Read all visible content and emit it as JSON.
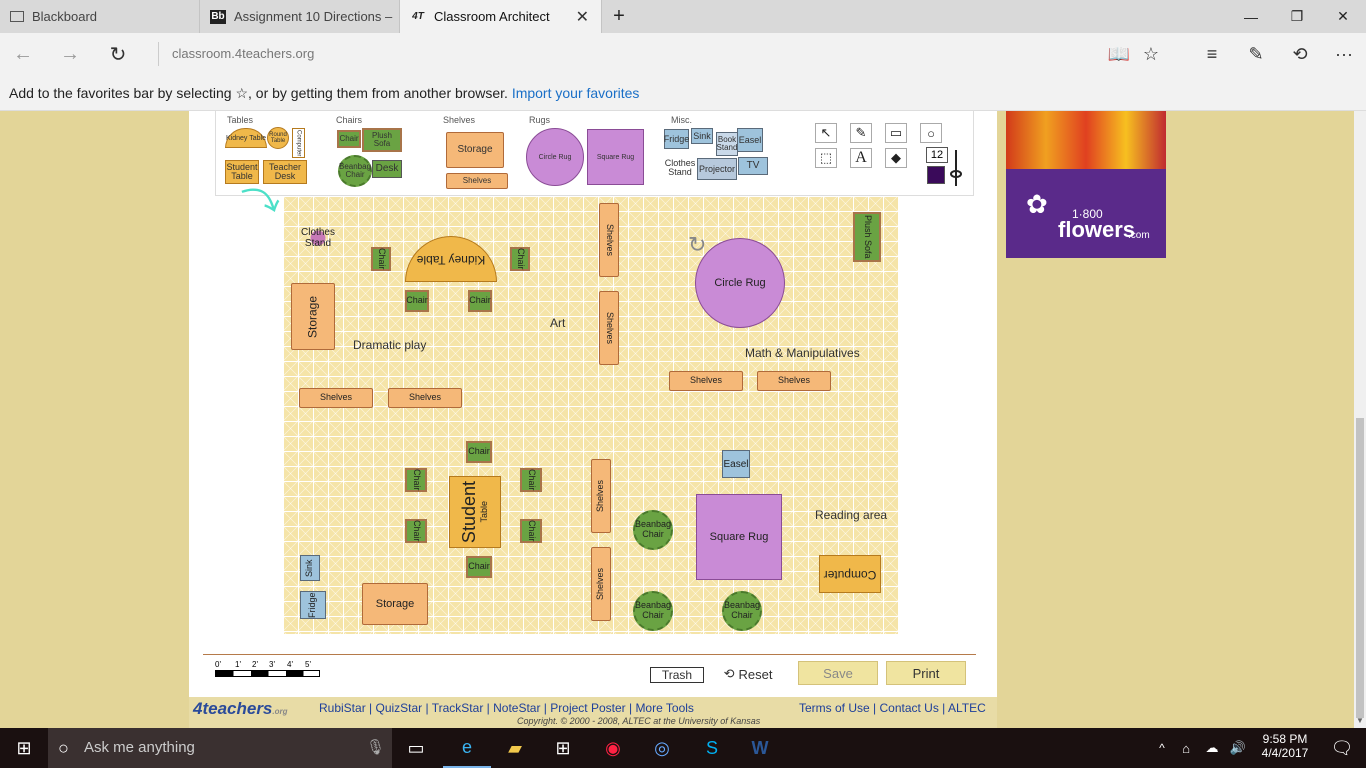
{
  "tabs": [
    {
      "label": "Blackboard",
      "icon": "window-icon"
    },
    {
      "label": "Assignment 10 Directions –",
      "icon": "Bb"
    },
    {
      "label": "Classroom Architect",
      "icon": "4T"
    }
  ],
  "address": {
    "url": "classroom.4teachers.org"
  },
  "favbar": {
    "text": "Add to the favorites bar by selecting ☆, or by getting them from another browser.",
    "link": "Import your favorites"
  },
  "palette": {
    "sections": {
      "tables": "Tables",
      "chairs": "Chairs",
      "shelves": "Shelves",
      "rugs": "Rugs",
      "misc": "Misc."
    },
    "tables": [
      "Kidney Table",
      "Round Table",
      "Computer",
      "Student Table",
      "Teacher Desk"
    ],
    "chairs": [
      "Chair",
      "Plush Sofa",
      "Beanbag Chair",
      "Desk"
    ],
    "shelves": [
      "Storage",
      "Shelves"
    ],
    "rugs": [
      "Circle Rug",
      "Square Rug"
    ],
    "misc": [
      "Fridge",
      "Sink",
      "Book Stand",
      "Easel",
      "Clothes Stand",
      "Projector",
      "TV"
    ],
    "font_size": "12"
  },
  "room": {
    "clothes_stand": "Clothes Stand",
    "kidney": "Kidney Table",
    "chair": "Chair",
    "storage": "Storage",
    "shelves": "Shelves",
    "circle_rug": "Circle Rug",
    "plush_sofa": "Plush Sofa",
    "student": "Student",
    "table": "Table",
    "easel": "Easel",
    "beanbag": "Beanbag Chair",
    "square_rug": "Square Rug",
    "computer": "Computer",
    "sink": "Sink",
    "fridge": "Fridge",
    "labels": {
      "dramatic": "Dramatic play",
      "art": "Art",
      "math": "Math & Manipulatives",
      "reading": "Reading area"
    }
  },
  "scale": {
    "ticks": [
      "0'",
      "1'",
      "2'",
      "3'",
      "4'",
      "5'"
    ]
  },
  "actions": {
    "trash": "Trash",
    "reset": "Reset",
    "save": "Save",
    "print": "Print"
  },
  "footer": {
    "logo": "4teachers",
    "logo_suffix": ".org",
    "links": [
      "RubiStar",
      "QuizStar",
      "TrackStar",
      "NoteStar",
      "Project Poster",
      "More Tools"
    ],
    "right_links": [
      "Terms of Use",
      "Contact Us",
      "ALTEC"
    ],
    "copyright": "Copyright. © 2000 - 2008, ALTEC at the University of Kansas"
  },
  "ad": {
    "brand": "1·800",
    "brand2": "flowers",
    "suffix": ".com"
  },
  "taskbar": {
    "search": "Ask me anything",
    "time": "9:58 PM",
    "date": "4/4/2017"
  },
  "colors": {
    "accent": "#1a6fc7",
    "table": "#f0b84a",
    "chair": "#6aa343",
    "rug": "#c98bd6",
    "shelf": "#f5b878"
  }
}
